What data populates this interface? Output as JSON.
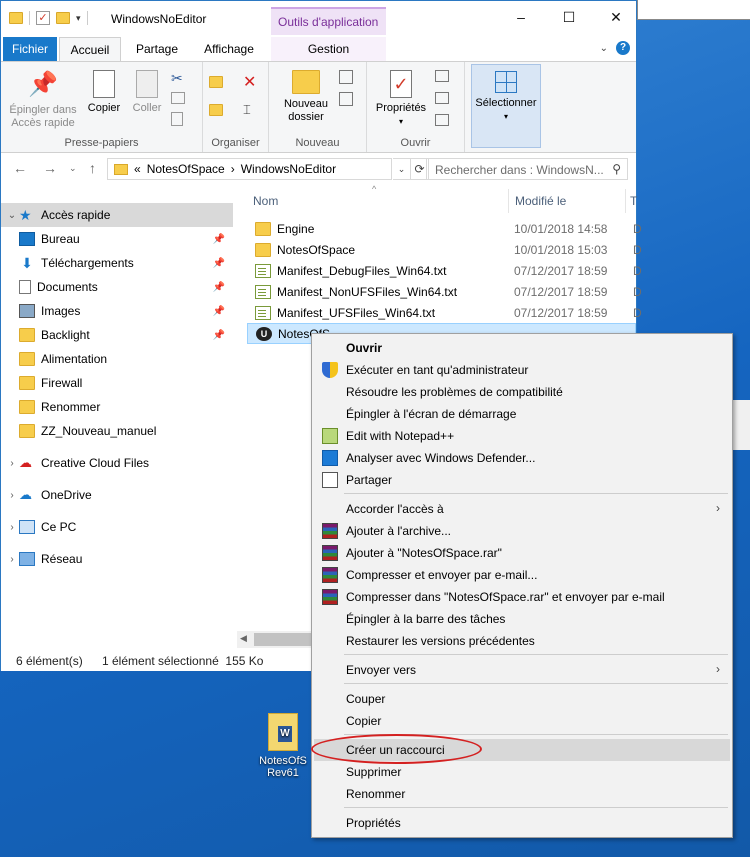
{
  "window": {
    "title": "WindowsNoEditor",
    "tools_tab": "Outils d'application"
  },
  "ribbon_tabs": {
    "fichier": "Fichier",
    "accueil": "Accueil",
    "partage": "Partage",
    "affichage": "Affichage",
    "gestion": "Gestion"
  },
  "ribbon": {
    "pin_label_1": "Épingler dans",
    "pin_label_2": "Accès rapide",
    "copier": "Copier",
    "coller": "Coller",
    "presse_papiers": "Presse-papiers",
    "organiser": "Organiser",
    "nouveau_dossier_1": "Nouveau",
    "nouveau_dossier_2": "dossier",
    "nouveau": "Nouveau",
    "proprietes": "Propriétés",
    "ouvrir": "Ouvrir",
    "selectionner": "Sélectionner"
  },
  "address": {
    "prefix": "«",
    "crumb_1": "NotesOfSpace",
    "sep": "›",
    "crumb_2": "WindowsNoEditor",
    "search_placeholder": "Rechercher dans : WindowsN..."
  },
  "nav": {
    "quick_access": "Accès rapide",
    "items": [
      {
        "label": "Bureau"
      },
      {
        "label": "Téléchargements"
      },
      {
        "label": "Documents"
      },
      {
        "label": "Images"
      },
      {
        "label": "Backlight"
      },
      {
        "label": "Alimentation"
      },
      {
        "label": "Firewall"
      },
      {
        "label": "Renommer"
      },
      {
        "label": "ZZ_Nouveau_manuel"
      }
    ],
    "creative_cloud": "Creative Cloud Files",
    "onedrive": "OneDrive",
    "ce_pc": "Ce PC",
    "reseau": "Réseau"
  },
  "files": {
    "col_nom": "Nom",
    "col_modifie": "Modifié le",
    "col_type": "T",
    "rows": [
      {
        "name": "Engine",
        "date": "10/01/2018 14:58",
        "type": "D"
      },
      {
        "name": "NotesOfSpace",
        "date": "10/01/2018 15:03",
        "type": "D"
      },
      {
        "name": "Manifest_DebugFiles_Win64.txt",
        "date": "07/12/2017 18:59",
        "type": "D"
      },
      {
        "name": "Manifest_NonUFSFiles_Win64.txt",
        "date": "07/12/2017 18:59",
        "type": "D"
      },
      {
        "name": "Manifest_UFSFiles_Win64.txt",
        "date": "07/12/2017 18:59",
        "type": "D"
      },
      {
        "name": "NotesOfS",
        "date": "",
        "type": ""
      }
    ]
  },
  "status": {
    "count": "6 élément(s)",
    "selected": "1 élément sélectionné  155 Ko"
  },
  "desktop_icon": {
    "line1": "NotesOfS",
    "line2": "Rev61"
  },
  "context_menu": {
    "ouvrir": "Ouvrir",
    "executer_admin": "Exécuter en tant qu'administrateur",
    "resoudre": "Résoudre les problèmes de compatibilité",
    "epingler_demarrage": "Épingler à l'écran de démarrage",
    "edit_notepad": "Edit with Notepad++",
    "analyser": "Analyser avec Windows Defender...",
    "partager": "Partager",
    "accorder": "Accorder l'accès à",
    "ajouter_archive": "Ajouter à l'archive...",
    "ajouter_rar": "Ajouter à \"NotesOfSpace.rar\"",
    "compresser_email": "Compresser et envoyer par e-mail...",
    "compresser_rar_email": "Compresser dans \"NotesOfSpace.rar\" et envoyer par e-mail",
    "epingler_barre": "Épingler à la barre des tâches",
    "restaurer": "Restaurer les versions précédentes",
    "envoyer_vers": "Envoyer vers",
    "couper": "Couper",
    "copier": "Copier",
    "creer_raccourci": "Créer un raccourci",
    "supprimer": "Supprimer",
    "renommer": "Renommer",
    "proprietes": "Propriétés"
  },
  "colors": {
    "accent": "#1979ca",
    "selection": "#cce8ff",
    "tools_tab": "#7a2f99",
    "annotation": "#d42020"
  }
}
